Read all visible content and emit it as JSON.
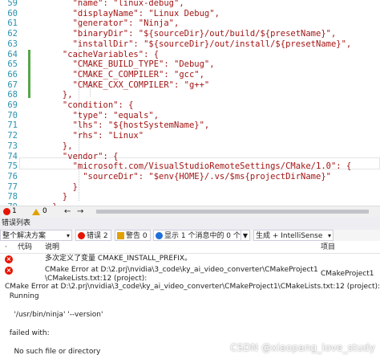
{
  "editor": {
    "lines": [
      {
        "n": "59",
        "text": "        \"name\": \"linux-debug\","
      },
      {
        "n": "60",
        "text": "        \"displayName\": \"Linux Debug\","
      },
      {
        "n": "61",
        "text": "        \"generator\": \"Ninja\","
      },
      {
        "n": "62",
        "text": "        \"binaryDir\": \"${sourceDir}/out/build/${presetName}\","
      },
      {
        "n": "63",
        "text": "        \"installDir\": \"${sourceDir}/out/install/${presetName}\","
      },
      {
        "n": "64",
        "text": "      \"cacheVariables\": {"
      },
      {
        "n": "65",
        "text": "        \"CMAKE_BUILD_TYPE\": \"Debug\","
      },
      {
        "n": "66",
        "text": "        \"CMAKE_C_COMPILER\": \"gcc\","
      },
      {
        "n": "67",
        "text": "        \"CMAKE_CXX_COMPILER\": \"g++\""
      },
      {
        "n": "68",
        "text": "      },"
      },
      {
        "n": "69",
        "text": "      \"condition\": {"
      },
      {
        "n": "70",
        "text": "        \"type\": \"equals\","
      },
      {
        "n": "71",
        "text": "        \"lhs\": \"${hostSystemName}\","
      },
      {
        "n": "72",
        "text": "        \"rhs\": \"Linux\""
      },
      {
        "n": "73",
        "text": "      },"
      },
      {
        "n": "74",
        "text": "      \"vendor\": {"
      },
      {
        "n": "75",
        "text": "        \"microsoft.com/VisualStudioRemoteSettings/CMake/1.0\": {"
      },
      {
        "n": "76",
        "text": "          \"sourceDir\": \"$env{HOME}/.vs/$ms{projectDirName}\""
      },
      {
        "n": "77",
        "text": "        }"
      },
      {
        "n": "78",
        "text": "      }"
      },
      {
        "n": "79",
        "text": "    }"
      }
    ]
  },
  "scrollbar": {
    "errors": "1",
    "warnings": "0",
    "arrow_left": "←",
    "arrow_right": "→"
  },
  "error_list": {
    "title": "错误列表",
    "scope": "整个解决方案",
    "errors_btn": "错误 2",
    "warnings_btn": "警告 0",
    "messages_btn": "显示 1 个消息中的 0 个",
    "source": "生成 + IntelliSense",
    "columns": {
      "code": "代码",
      "description": "说明",
      "project": "项目"
    },
    "rows": [
      {
        "description": "多次定义了变量 CMAKE_INSTALL_PREFIX。",
        "project": ""
      },
      {
        "description": "CMake Error at D:\\2.prj\\nvidia\\3_code\\ky_ai_video_converter\\CMakeProject1\n\\CMakeLists.txt:12 (project):",
        "project": "CMakeProject1"
      }
    ],
    "detail": "CMake Error at D:\\2.prj\\nvidia\\3_code\\ky_ai_video_converter\\CMakeProject1\\CMakeLists.txt:12 (project):\n  Running\n\n    '/usr/bin/ninja' '--version'\n\n  failed with:\n\n    No such file or directory"
  },
  "watermark": "CSDN @xiaopang_love_study"
}
